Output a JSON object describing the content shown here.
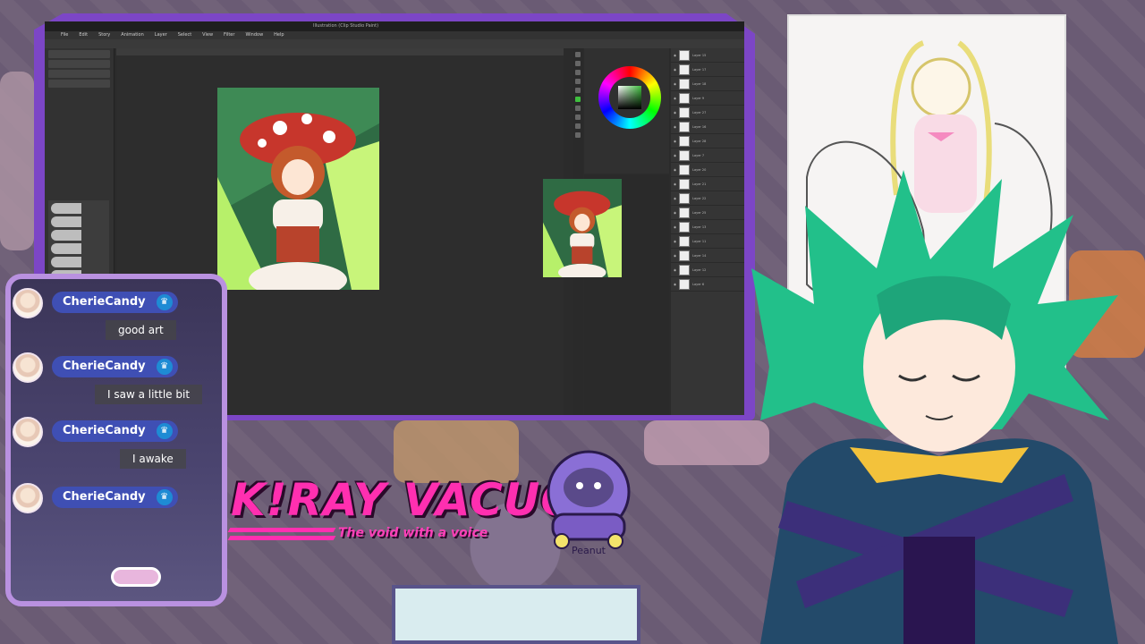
{
  "software": {
    "title": "Illustration (Clip Studio Paint)",
    "menu": [
      "File",
      "Edit",
      "Story",
      "Animation",
      "Layer",
      "Select",
      "View",
      "Filter",
      "Window",
      "Help"
    ]
  },
  "layers": [
    "Layer 15",
    "Layer 17",
    "Layer 18",
    "Layer 9",
    "Layer 27",
    "Layer 16",
    "Layer 28",
    "Layer 7",
    "Layer 20",
    "Layer 21",
    "Layer 22",
    "Layer 25",
    "Layer 13",
    "Layer 11",
    "Layer 14",
    "Layer 12",
    "Layer 6"
  ],
  "chat": {
    "messages": [
      {
        "user": "CherieCandy",
        "text": "good art"
      },
      {
        "user": "CherieCandy",
        "text": "I saw a little bit"
      },
      {
        "user": "CherieCandy",
        "text": "I awake"
      },
      {
        "user": "CherieCandy",
        "text": ""
      }
    ]
  },
  "logo": {
    "title": "K!RAY VACUO",
    "subtitle": "The void with a voice"
  },
  "mascot": {
    "label": "Peanut"
  },
  "colors": {
    "frame": "#7c46c6",
    "chat_border": "#b991e0",
    "logo": "#ff2fb0",
    "name_pill": "#3f4fb4"
  }
}
